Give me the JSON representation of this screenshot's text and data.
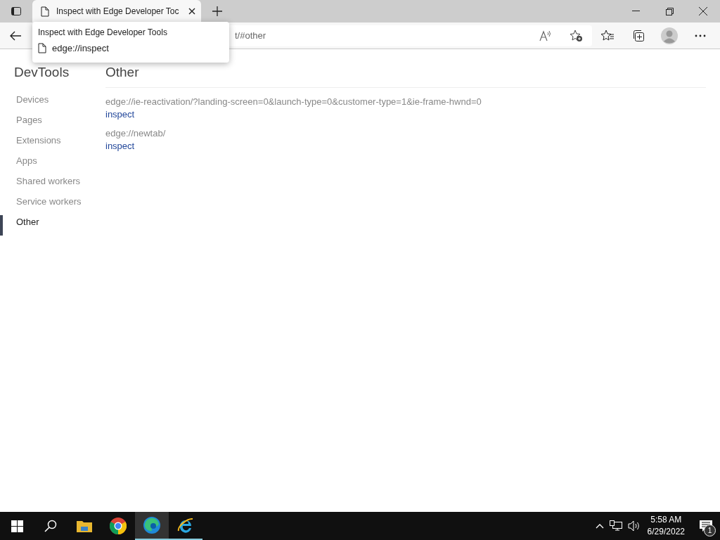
{
  "browser": {
    "tabs": [
      {
        "title": "Inspect with Edge Developer Toc",
        "selected": true
      }
    ],
    "address": "t/#other",
    "tab_tooltip": {
      "title": "Inspect with Edge Developer Tools",
      "url": "edge://inspect"
    }
  },
  "sidebar": {
    "title": "DevTools",
    "items": [
      {
        "label": "Devices",
        "selected": false
      },
      {
        "label": "Pages",
        "selected": false
      },
      {
        "label": "Extensions",
        "selected": false
      },
      {
        "label": "Apps",
        "selected": false
      },
      {
        "label": "Shared workers",
        "selected": false
      },
      {
        "label": "Service workers",
        "selected": false
      },
      {
        "label": "Other",
        "selected": true
      }
    ]
  },
  "main": {
    "title": "Other",
    "targets": [
      {
        "url": "edge://ie-reactivation/?landing-screen=0&launch-type=0&customer-type=1&ie-frame-hwnd=0",
        "action": "inspect"
      },
      {
        "url": "edge://newtab/",
        "action": "inspect"
      }
    ]
  },
  "taskbar": {
    "apps": [
      {
        "kind": "explorer",
        "active": false,
        "running": false
      },
      {
        "kind": "chrome",
        "active": false,
        "running": false
      },
      {
        "kind": "edge",
        "active": true,
        "running": true
      },
      {
        "kind": "ie",
        "active": false,
        "running": true
      }
    ],
    "time": "5:58 AM",
    "date": "6/29/2022",
    "notifications": "1"
  }
}
